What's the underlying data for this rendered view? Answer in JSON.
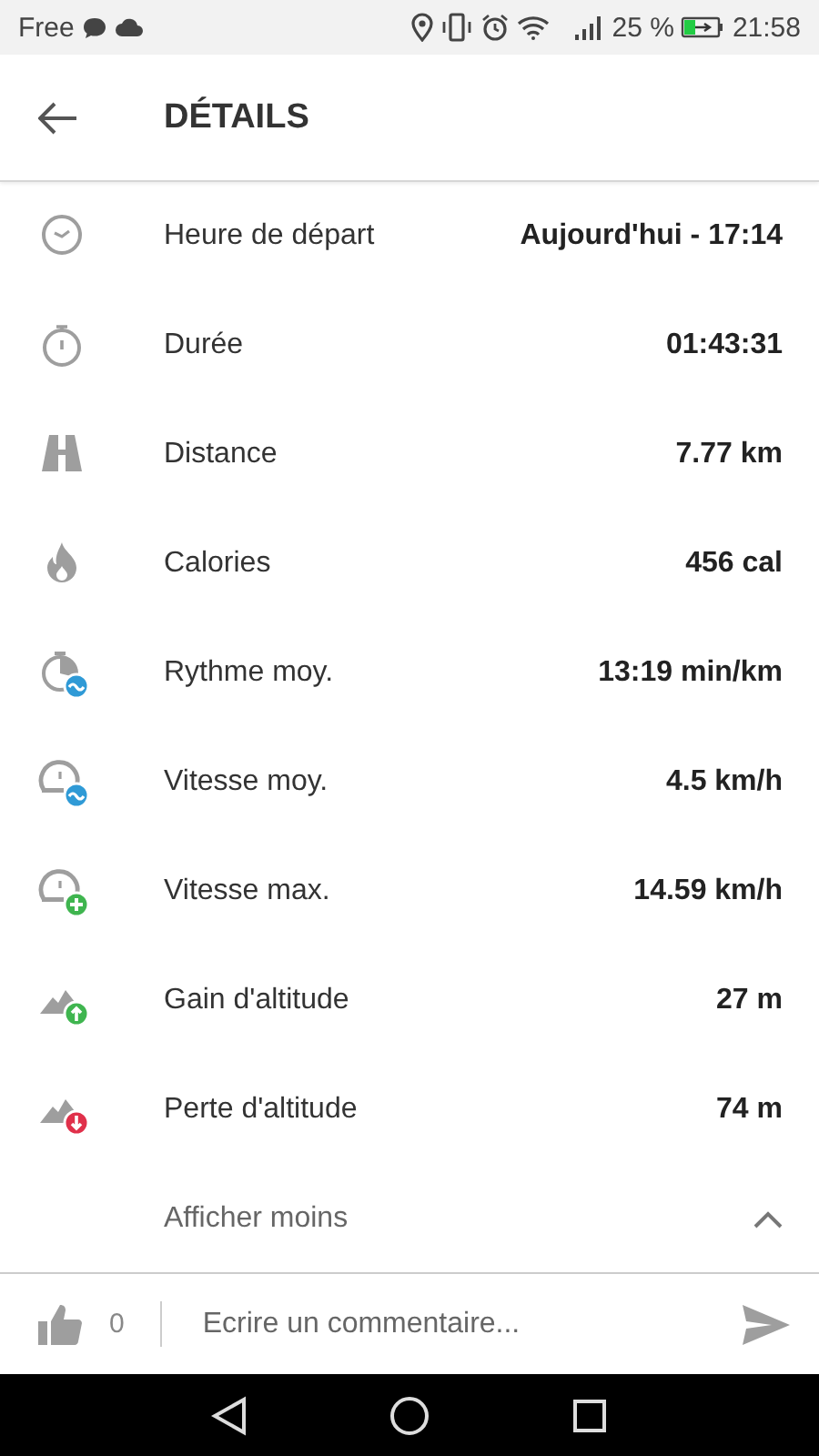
{
  "status_bar": {
    "carrier": "Free",
    "battery": "25 %",
    "time": "21:58"
  },
  "header": {
    "title": "DÉTAILS"
  },
  "details": [
    {
      "kind": "clock",
      "label": "Heure de départ",
      "value": "Aujourd'hui - 17:14"
    },
    {
      "kind": "stopwatch",
      "label": "Durée",
      "value": "01:43:31"
    },
    {
      "kind": "road",
      "label": "Distance",
      "value": "7.77 km"
    },
    {
      "kind": "flame",
      "label": "Calories",
      "value": "456 cal"
    },
    {
      "kind": "pace",
      "label": "Rythme moy.",
      "value": "13:19 min/km"
    },
    {
      "kind": "avgspeed",
      "label": "Vitesse moy.",
      "value": "4.5 km/h"
    },
    {
      "kind": "maxspeed",
      "label": "Vitesse max.",
      "value": "14.59 km/h"
    },
    {
      "kind": "climb",
      "label": "Gain d'altitude",
      "value": "27 m"
    },
    {
      "kind": "descent",
      "label": "Perte d'altitude",
      "value": "74 m"
    }
  ],
  "toggle": {
    "label": "Afficher moins",
    "expanded": true
  },
  "comment_bar": {
    "likes": "0",
    "placeholder": "Ecrire un commentaire..."
  }
}
